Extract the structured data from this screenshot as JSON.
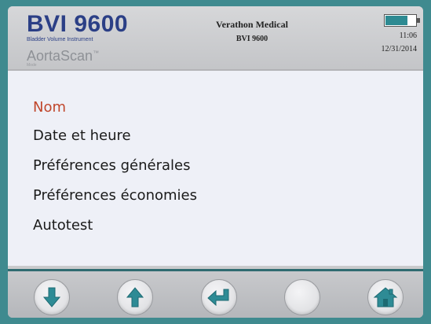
{
  "header": {
    "brand_title": "BVI 9600",
    "brand_subtitle": "Bladder Volume Instrument",
    "product": "AortaScan",
    "product_tm": "™",
    "mode_label": "Mode",
    "manufacturer": "Verathon Medical",
    "model": "BVI 9600",
    "time": "11:06",
    "date": "12/31/2014",
    "battery_level": 0.7
  },
  "menu": {
    "items": [
      {
        "label": "Nom",
        "selected": true
      },
      {
        "label": "Date et heure",
        "selected": false
      },
      {
        "label": "Préférences générales",
        "selected": false
      },
      {
        "label": "Préférences économies",
        "selected": false
      },
      {
        "label": "Autotest",
        "selected": false
      }
    ]
  },
  "toolbar": {
    "buttons": [
      {
        "icon": "down-arrow-icon"
      },
      {
        "icon": "up-arrow-icon"
      },
      {
        "icon": "enter-icon"
      },
      {
        "icon": "blank"
      },
      {
        "icon": "home-icon"
      }
    ]
  },
  "colors": {
    "accent_teal": "#3f8a8f",
    "brand_blue": "#2b3f86",
    "selected_red": "#c0462b",
    "icon_teal": "#2e8b95"
  }
}
